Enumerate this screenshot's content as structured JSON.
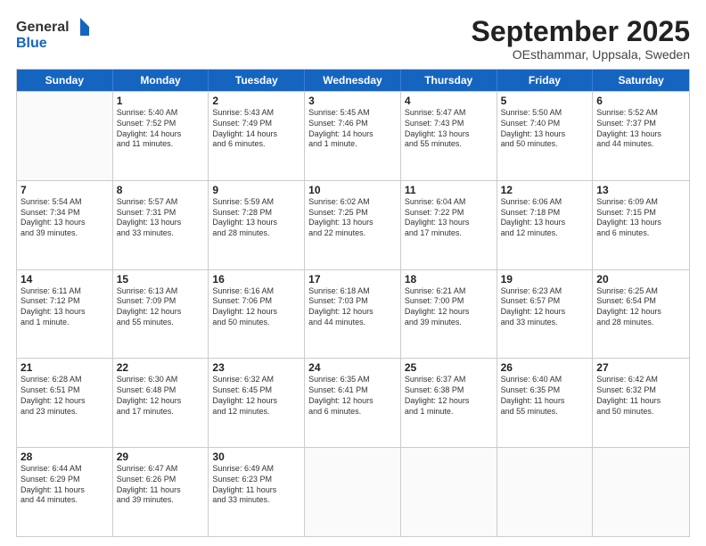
{
  "header": {
    "logo_general": "General",
    "logo_blue": "Blue",
    "month_title": "September 2025",
    "subtitle": "OEsthammar, Uppsala, Sweden"
  },
  "days_of_week": [
    "Sunday",
    "Monday",
    "Tuesday",
    "Wednesday",
    "Thursday",
    "Friday",
    "Saturday"
  ],
  "weeks": [
    [
      {
        "day": "",
        "lines": []
      },
      {
        "day": "1",
        "lines": [
          "Sunrise: 5:40 AM",
          "Sunset: 7:52 PM",
          "Daylight: 14 hours",
          "and 11 minutes."
        ]
      },
      {
        "day": "2",
        "lines": [
          "Sunrise: 5:43 AM",
          "Sunset: 7:49 PM",
          "Daylight: 14 hours",
          "and 6 minutes."
        ]
      },
      {
        "day": "3",
        "lines": [
          "Sunrise: 5:45 AM",
          "Sunset: 7:46 PM",
          "Daylight: 14 hours",
          "and 1 minute."
        ]
      },
      {
        "day": "4",
        "lines": [
          "Sunrise: 5:47 AM",
          "Sunset: 7:43 PM",
          "Daylight: 13 hours",
          "and 55 minutes."
        ]
      },
      {
        "day": "5",
        "lines": [
          "Sunrise: 5:50 AM",
          "Sunset: 7:40 PM",
          "Daylight: 13 hours",
          "and 50 minutes."
        ]
      },
      {
        "day": "6",
        "lines": [
          "Sunrise: 5:52 AM",
          "Sunset: 7:37 PM",
          "Daylight: 13 hours",
          "and 44 minutes."
        ]
      }
    ],
    [
      {
        "day": "7",
        "lines": [
          "Sunrise: 5:54 AM",
          "Sunset: 7:34 PM",
          "Daylight: 13 hours",
          "and 39 minutes."
        ]
      },
      {
        "day": "8",
        "lines": [
          "Sunrise: 5:57 AM",
          "Sunset: 7:31 PM",
          "Daylight: 13 hours",
          "and 33 minutes."
        ]
      },
      {
        "day": "9",
        "lines": [
          "Sunrise: 5:59 AM",
          "Sunset: 7:28 PM",
          "Daylight: 13 hours",
          "and 28 minutes."
        ]
      },
      {
        "day": "10",
        "lines": [
          "Sunrise: 6:02 AM",
          "Sunset: 7:25 PM",
          "Daylight: 13 hours",
          "and 22 minutes."
        ]
      },
      {
        "day": "11",
        "lines": [
          "Sunrise: 6:04 AM",
          "Sunset: 7:22 PM",
          "Daylight: 13 hours",
          "and 17 minutes."
        ]
      },
      {
        "day": "12",
        "lines": [
          "Sunrise: 6:06 AM",
          "Sunset: 7:18 PM",
          "Daylight: 13 hours",
          "and 12 minutes."
        ]
      },
      {
        "day": "13",
        "lines": [
          "Sunrise: 6:09 AM",
          "Sunset: 7:15 PM",
          "Daylight: 13 hours",
          "and 6 minutes."
        ]
      }
    ],
    [
      {
        "day": "14",
        "lines": [
          "Sunrise: 6:11 AM",
          "Sunset: 7:12 PM",
          "Daylight: 13 hours",
          "and 1 minute."
        ]
      },
      {
        "day": "15",
        "lines": [
          "Sunrise: 6:13 AM",
          "Sunset: 7:09 PM",
          "Daylight: 12 hours",
          "and 55 minutes."
        ]
      },
      {
        "day": "16",
        "lines": [
          "Sunrise: 6:16 AM",
          "Sunset: 7:06 PM",
          "Daylight: 12 hours",
          "and 50 minutes."
        ]
      },
      {
        "day": "17",
        "lines": [
          "Sunrise: 6:18 AM",
          "Sunset: 7:03 PM",
          "Daylight: 12 hours",
          "and 44 minutes."
        ]
      },
      {
        "day": "18",
        "lines": [
          "Sunrise: 6:21 AM",
          "Sunset: 7:00 PM",
          "Daylight: 12 hours",
          "and 39 minutes."
        ]
      },
      {
        "day": "19",
        "lines": [
          "Sunrise: 6:23 AM",
          "Sunset: 6:57 PM",
          "Daylight: 12 hours",
          "and 33 minutes."
        ]
      },
      {
        "day": "20",
        "lines": [
          "Sunrise: 6:25 AM",
          "Sunset: 6:54 PM",
          "Daylight: 12 hours",
          "and 28 minutes."
        ]
      }
    ],
    [
      {
        "day": "21",
        "lines": [
          "Sunrise: 6:28 AM",
          "Sunset: 6:51 PM",
          "Daylight: 12 hours",
          "and 23 minutes."
        ]
      },
      {
        "day": "22",
        "lines": [
          "Sunrise: 6:30 AM",
          "Sunset: 6:48 PM",
          "Daylight: 12 hours",
          "and 17 minutes."
        ]
      },
      {
        "day": "23",
        "lines": [
          "Sunrise: 6:32 AM",
          "Sunset: 6:45 PM",
          "Daylight: 12 hours",
          "and 12 minutes."
        ]
      },
      {
        "day": "24",
        "lines": [
          "Sunrise: 6:35 AM",
          "Sunset: 6:41 PM",
          "Daylight: 12 hours",
          "and 6 minutes."
        ]
      },
      {
        "day": "25",
        "lines": [
          "Sunrise: 6:37 AM",
          "Sunset: 6:38 PM",
          "Daylight: 12 hours",
          "and 1 minute."
        ]
      },
      {
        "day": "26",
        "lines": [
          "Sunrise: 6:40 AM",
          "Sunset: 6:35 PM",
          "Daylight: 11 hours",
          "and 55 minutes."
        ]
      },
      {
        "day": "27",
        "lines": [
          "Sunrise: 6:42 AM",
          "Sunset: 6:32 PM",
          "Daylight: 11 hours",
          "and 50 minutes."
        ]
      }
    ],
    [
      {
        "day": "28",
        "lines": [
          "Sunrise: 6:44 AM",
          "Sunset: 6:29 PM",
          "Daylight: 11 hours",
          "and 44 minutes."
        ]
      },
      {
        "day": "29",
        "lines": [
          "Sunrise: 6:47 AM",
          "Sunset: 6:26 PM",
          "Daylight: 11 hours",
          "and 39 minutes."
        ]
      },
      {
        "day": "30",
        "lines": [
          "Sunrise: 6:49 AM",
          "Sunset: 6:23 PM",
          "Daylight: 11 hours",
          "and 33 minutes."
        ]
      },
      {
        "day": "",
        "lines": []
      },
      {
        "day": "",
        "lines": []
      },
      {
        "day": "",
        "lines": []
      },
      {
        "day": "",
        "lines": []
      }
    ]
  ]
}
